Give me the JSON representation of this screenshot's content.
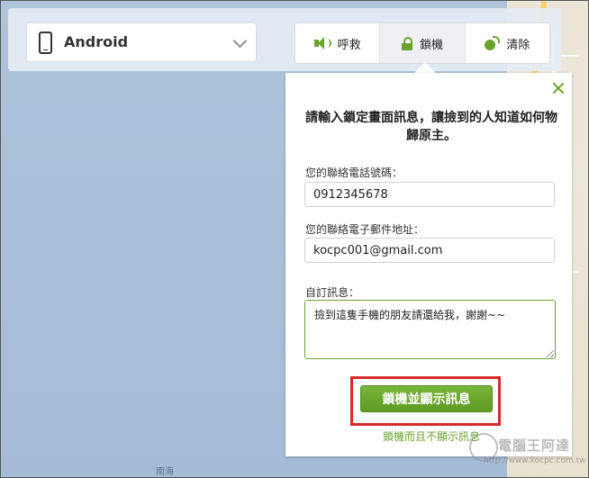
{
  "device": {
    "name": "Android"
  },
  "actions": [
    {
      "label": "呼救",
      "icon": "speaker-icon"
    },
    {
      "label": "鎖機",
      "icon": "lock-icon",
      "active": true
    },
    {
      "label": "清除",
      "icon": "bomb-icon"
    }
  ],
  "panel": {
    "title": "請輸入鎖定畫面訊息，讓撿到的人知道如何物歸原主。",
    "phone_label": "您的聯絡電話號碼：",
    "phone_value": "0912345678",
    "email_label": "您的聯絡電子郵件地址：",
    "email_value": "kocpc001@gmail.com",
    "message_label": "自訂訊息：",
    "message_value": "撿到這隻手機的朋友請還給我，謝謝~~",
    "primary_button": "鎖機並顯示訊息",
    "secondary_link": "鎖機而且不顯示訊息"
  },
  "map": {
    "labels": [
      "南海"
    ]
  },
  "watermark": {
    "title": "電腦王阿達",
    "url": "http://www.kocpc.com.tw"
  },
  "colors": {
    "accent": "#6aa22e",
    "highlight": "#d62a2a",
    "map_sea": "#a9bfd9"
  }
}
